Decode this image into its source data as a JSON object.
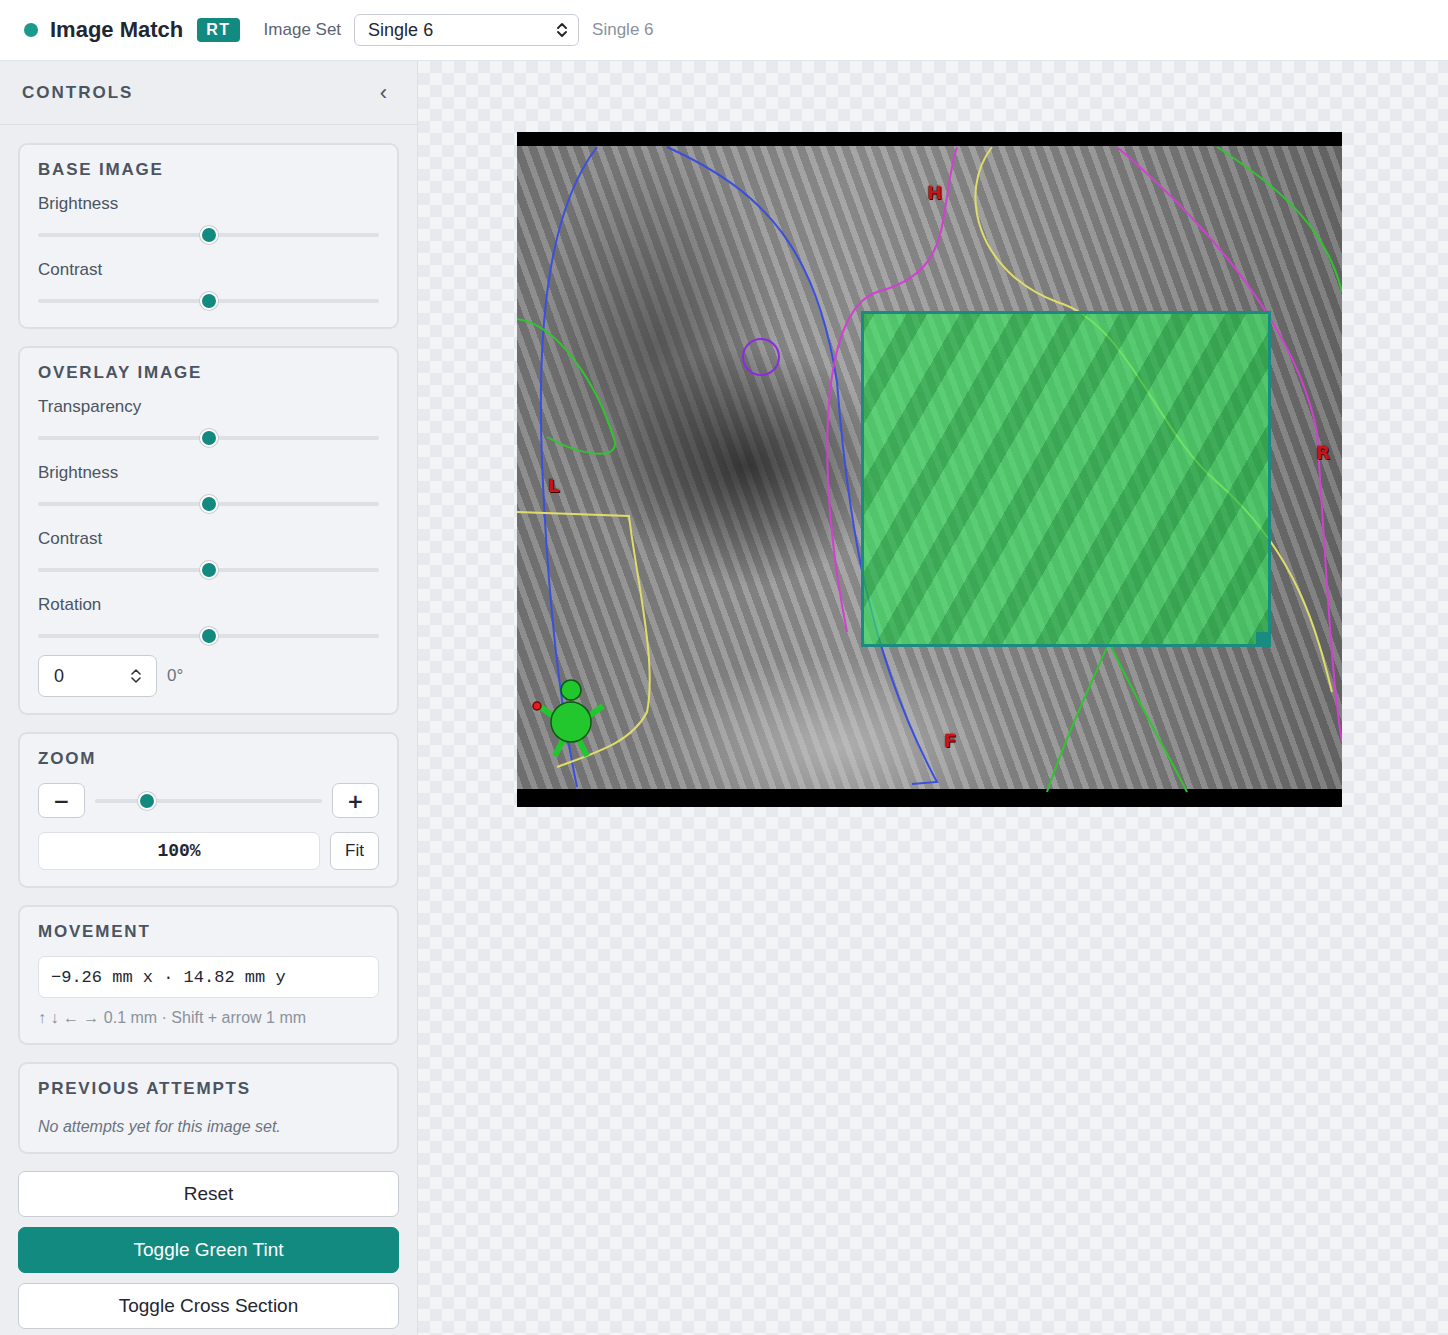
{
  "app": {
    "title": "Image Match",
    "badge": "RT",
    "status_color": "#1a9a8c"
  },
  "image_set": {
    "label": "Image Set",
    "value": "Single 6",
    "caption": "Single 6"
  },
  "controls": {
    "title": "CONTROLS",
    "collapse": "‹"
  },
  "base_image": {
    "title": "BASE IMAGE",
    "sliders": [
      {
        "label": "Brightness",
        "level": 0.5
      },
      {
        "label": "Contrast",
        "level": 0.5
      }
    ]
  },
  "overlay_image": {
    "title": "OVERLAY IMAGE",
    "sliders": [
      {
        "label": "Transparency",
        "level": 0.5
      },
      {
        "label": "Brightness",
        "level": 0.5
      },
      {
        "label": "Contrast",
        "level": 0.5
      },
      {
        "label": "Rotation",
        "level": 0.5
      }
    ],
    "rotation_value": "0",
    "rotation_unit": "0°"
  },
  "zoom": {
    "title": "ZOOM",
    "minus": "−",
    "plus": "+",
    "level": 0.23,
    "value": "100%",
    "fit": "Fit"
  },
  "movement": {
    "title": "MOVEMENT",
    "value": "−9.26 mm x · 14.82 mm y",
    "hint": "↑ ↓ ← → 0.1 mm · Shift + arrow 1 mm"
  },
  "previous_attempts": {
    "title": "PREVIOUS ATTEMPTS",
    "empty": "No attempts yet for this image set."
  },
  "buttons": [
    {
      "label": "Reset",
      "primary": false
    },
    {
      "label": "Toggle Green Tint",
      "primary": true
    },
    {
      "label": "Toggle Cross Section",
      "primary": false
    }
  ],
  "viewer": {
    "green_tint": true,
    "orientation_labels": [
      "H",
      "L",
      "R",
      "F"
    ]
  }
}
